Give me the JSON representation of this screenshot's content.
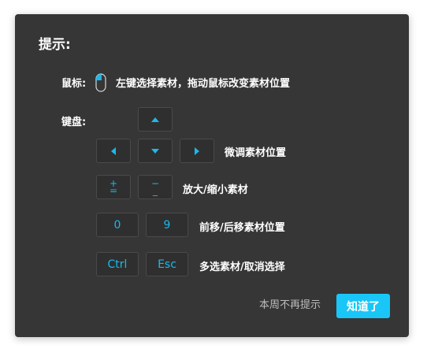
{
  "dialog": {
    "title": "提示:",
    "mouse_label": "鼠标:",
    "mouse_desc": "左键选择素材，拖动鼠标改变素材位置",
    "keyboard_label": "键盘:",
    "row_arrows_desc": "微调素材位置",
    "row_zoom_desc": "放大/缩小素材",
    "row_order_desc": "前移/后移素材位置",
    "row_select_desc": "多选素材/取消选择",
    "keys": {
      "plus_top": "+",
      "plus_bottom": "=",
      "minus_top": "−",
      "minus_bottom": "_",
      "zero": "0",
      "nine": "9",
      "ctrl": "Ctrl",
      "esc": "Esc"
    },
    "footer_link": "本周不再提示",
    "ok_button": "知道了"
  },
  "colors": {
    "dialog_bg": "#363636",
    "accent": "#19b9ee",
    "button_bg": "#19c6f7"
  },
  "icons": {
    "mouse": "mouse-icon",
    "up": "arrow-up-icon",
    "down": "arrow-down-icon",
    "left": "arrow-left-icon",
    "right": "arrow-right-icon"
  }
}
